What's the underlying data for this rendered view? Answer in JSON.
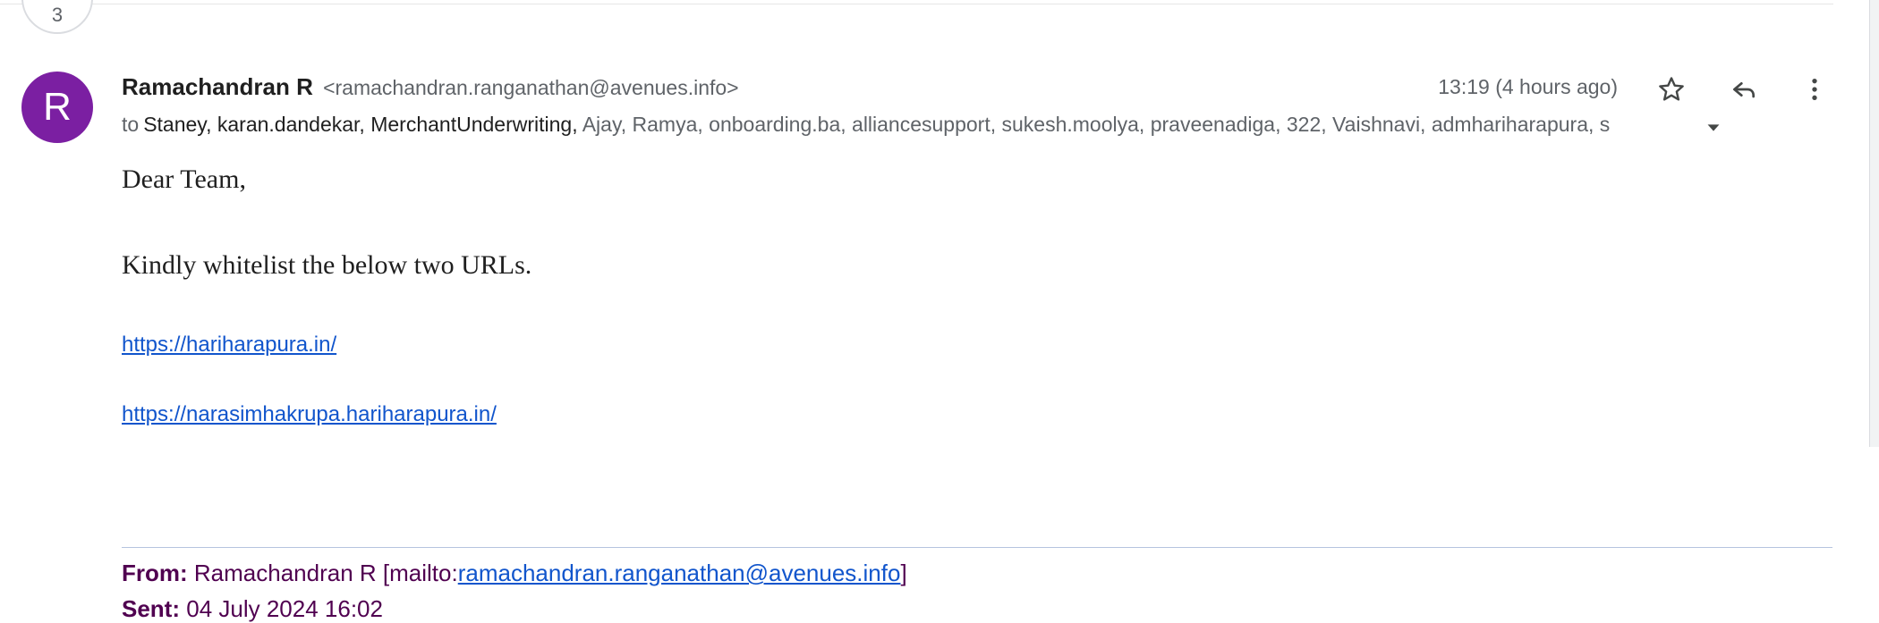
{
  "thread": {
    "count": "3"
  },
  "message": {
    "avatar_letter": "R",
    "sender_name": "Ramachandran R",
    "sender_email": "<ramachandran.ranganathan@avenues.info>",
    "timestamp": "13:19 (4 hours ago)",
    "recipients_label": "to",
    "recipients_primary": "Staney, karan.dandekar, MerchantUnderwriting,",
    "recipients_rest": "Ajay, Ramya, onboarding.ba, alliancesupport, sukesh.moolya, praveenadiga, 322, Vaishnavi, admhariharapura, s",
    "actions": {
      "star_icon": "star-outline",
      "reply_icon": "reply-arrow",
      "more_icon": "vertical-dots"
    }
  },
  "body": {
    "greeting": "Dear Team,",
    "request": "Kindly whitelist the below two URLs.",
    "urls": [
      "https://hariharapura.in/",
      "https://narasimhakrupa.hariharapura.in/"
    ]
  },
  "quoted": {
    "from_label": "From:",
    "from_name": "Ramachandran R [mailto:",
    "from_email": "ramachandran.ranganathan@avenues.info",
    "from_close": "]",
    "sent_label": "Sent:",
    "sent_value": "04 July 2024 16:02"
  },
  "colors": {
    "avatar": "#7b1fa2",
    "link": "#1155cc",
    "quote_text": "#500050"
  }
}
